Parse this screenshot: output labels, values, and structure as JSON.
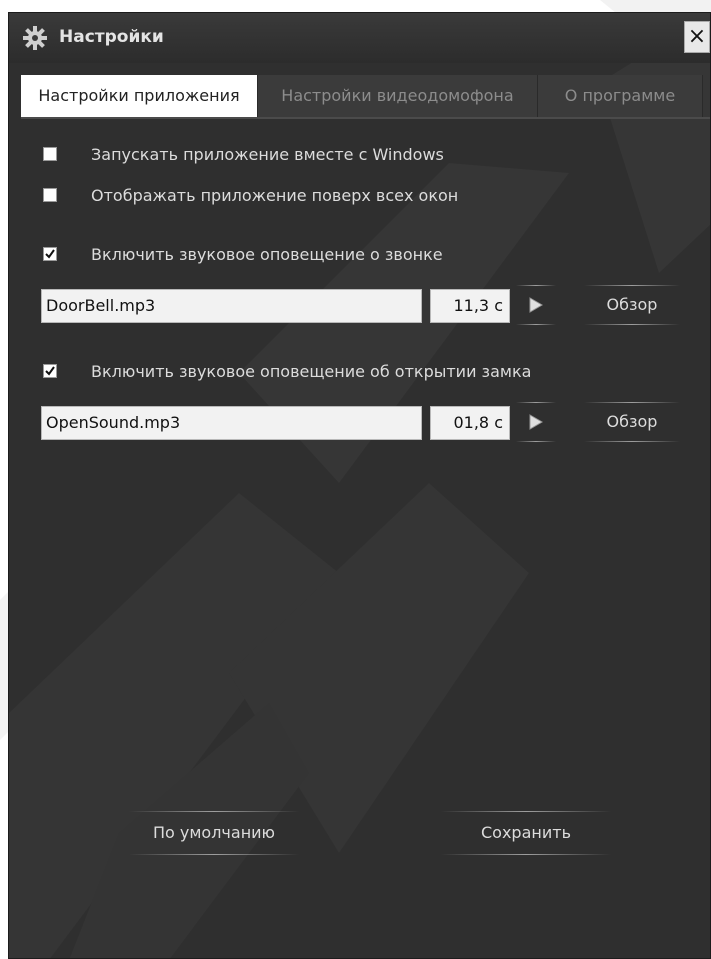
{
  "window": {
    "title": "Настройки",
    "icon": "gear-icon",
    "close_symbol": "×"
  },
  "tabs": [
    {
      "label": "Настройки приложения",
      "active": true
    },
    {
      "label": "Настройки видеодомофона",
      "active": false
    },
    {
      "label": "О программе",
      "active": false
    }
  ],
  "settings": {
    "autostart": {
      "label": "Запускать приложение вместе с Windows",
      "checked": false
    },
    "on_top": {
      "label": "Отображать приложение поверх всех окон",
      "checked": false
    },
    "ring_sound": {
      "label": "Включить звуковое оповещение о звонке",
      "checked": true,
      "file": "DoorBell.mp3",
      "duration": "11,3 с",
      "browse_label": "Обзор"
    },
    "lock_sound": {
      "label": "Включить звуковое оповещение об открытии замка",
      "checked": true,
      "file": "OpenSound.mp3",
      "duration": "01,8 с",
      "browse_label": "Обзор"
    }
  },
  "footer": {
    "defaults_label": "По умолчанию",
    "save_label": "Сохранить"
  },
  "colors": {
    "window_bg": "#2f2f2f",
    "active_tab_bg": "#ffffff",
    "inactive_tab_text": "#8c8c8c",
    "text": "#dcdcdc"
  }
}
